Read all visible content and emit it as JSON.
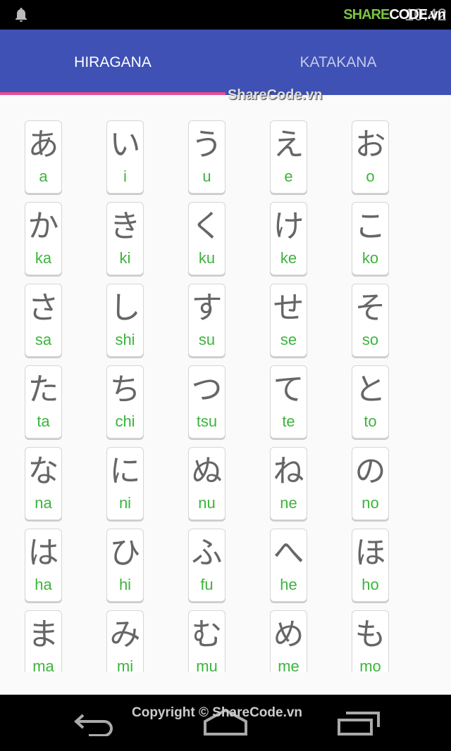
{
  "status_bar": {
    "watermark_a": "SHARE",
    "watermark_b": "CODE.vn",
    "time": "10:42"
  },
  "tabs": [
    {
      "label": "HIRAGANA",
      "selected": true
    },
    {
      "label": "KATAKANA",
      "selected": false
    }
  ],
  "watermark_center": "ShareCode.vn",
  "colors": {
    "primary": "#3f51b5",
    "indicator": "#e84e8f",
    "romaji": "#3cb43c"
  },
  "rows": [
    [
      [
        "あ",
        "a"
      ],
      [
        "い",
        "i"
      ],
      [
        "う",
        "u"
      ],
      [
        "え",
        "e"
      ],
      [
        "お",
        "o"
      ]
    ],
    [
      [
        "か",
        "ka"
      ],
      [
        "き",
        "ki"
      ],
      [
        "く",
        "ku"
      ],
      [
        "け",
        "ke"
      ],
      [
        "こ",
        "ko"
      ]
    ],
    [
      [
        "さ",
        "sa"
      ],
      [
        "し",
        "shi"
      ],
      [
        "す",
        "su"
      ],
      [
        "せ",
        "se"
      ],
      [
        "そ",
        "so"
      ]
    ],
    [
      [
        "た",
        "ta"
      ],
      [
        "ち",
        "chi"
      ],
      [
        "つ",
        "tsu"
      ],
      [
        "て",
        "te"
      ],
      [
        "と",
        "to"
      ]
    ],
    [
      [
        "な",
        "na"
      ],
      [
        "に",
        "ni"
      ],
      [
        "ぬ",
        "nu"
      ],
      [
        "ね",
        "ne"
      ],
      [
        "の",
        "no"
      ]
    ],
    [
      [
        "は",
        "ha"
      ],
      [
        "ひ",
        "hi"
      ],
      [
        "ふ",
        "fu"
      ],
      [
        "へ",
        "he"
      ],
      [
        "ほ",
        "ho"
      ]
    ],
    [
      [
        "ま",
        "ma"
      ],
      [
        "み",
        "mi"
      ],
      [
        "む",
        "mu"
      ],
      [
        "め",
        "me"
      ],
      [
        "も",
        "mo"
      ]
    ]
  ],
  "footer": {
    "copyright": "Copyright © ShareCode.vn"
  }
}
